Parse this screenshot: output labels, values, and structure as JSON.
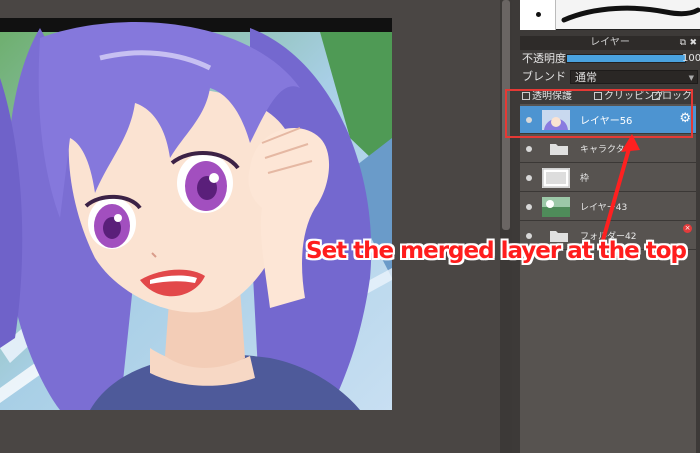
{
  "layer_panel": {
    "title": "レイヤー",
    "opacity_label": "不透明度",
    "opacity_value": "100",
    "opacity_percent": 100,
    "blend_label": "ブレンド",
    "blend_value": "通常",
    "protect_alpha_label": "透明保護",
    "clipping_label": "クリッピング",
    "lock_label": "ロック",
    "layers": [
      {
        "name": "レイヤー56",
        "selected": true,
        "kind": "image"
      },
      {
        "name": "キャラクター",
        "selected": false,
        "kind": "folder"
      },
      {
        "name": "枠",
        "selected": false,
        "kind": "image"
      },
      {
        "name": "レイヤー43",
        "selected": false,
        "kind": "image"
      },
      {
        "name": "フォルダー42",
        "selected": false,
        "kind": "folder"
      }
    ]
  },
  "annotation": {
    "text": "Set the merged layer at the top"
  },
  "colors": {
    "selected_layer": "#4d94d1",
    "annotation_red": "#ff1d1d",
    "opacity_bar": "#4aa3e0"
  },
  "icons": [
    "eye-icon",
    "folder-icon",
    "gear-icon",
    "delete-icon",
    "popout-icon",
    "close-icon",
    "chevron-down-icon"
  ]
}
